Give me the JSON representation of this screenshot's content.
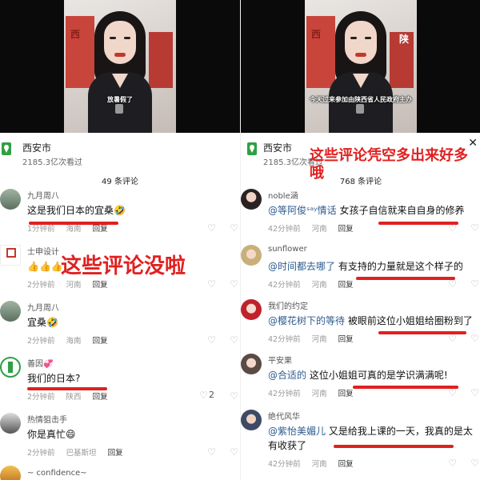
{
  "left": {
    "subtitle": "放暑假了",
    "location": {
      "name": "西安市",
      "views": "2185.3亿次看过"
    },
    "comment_count": "49 条评论",
    "annotation": "这些评论没啦",
    "comments": [
      {
        "user": "九月周八",
        "text": "这是我们日本的宜桑🤣",
        "time": "1分钟前",
        "region": "海南",
        "reply": "回复",
        "likes": ""
      },
      {
        "user": "士申设计",
        "text": "👍👍👍",
        "time": "2分钟前",
        "region": "河南",
        "reply": "回复",
        "likes": ""
      },
      {
        "user": "九月周八",
        "text": "宜桑🤣",
        "time": "2分钟前",
        "region": "海南",
        "reply": "回复",
        "likes": ""
      },
      {
        "user": "善因💞",
        "text": "我们的日本?",
        "time": "2分钟前",
        "region": "陕西",
        "reply": "回复",
        "likes": "2"
      },
      {
        "user": "热情狙击手",
        "text": "你是真忙😄",
        "time": "2分钟前",
        "region": "巴基斯坦",
        "reply": "回复",
        "likes": ""
      },
      {
        "user": "~ confidence~",
        "text": "",
        "time": "",
        "region": "",
        "reply": "",
        "likes": ""
      }
    ]
  },
  "right": {
    "subtitle": "今天过来参加由陕西省人民政府主办",
    "location": {
      "name": "西安市",
      "views": "2185.3亿次看过"
    },
    "comment_count": "768 条评论",
    "annotation": "这些评论凭空多出来好多哦",
    "comments": [
      {
        "user": "noble涵",
        "mention": "@等阿俊ˢᵃʸ情话",
        "text": "女孩子自信就来自自身的修养",
        "time": "42分钟前",
        "region": "河南",
        "reply": "回复"
      },
      {
        "user": "sunflower",
        "mention": "@时间都去哪了",
        "text": "有支持的力量就是这个样子的",
        "time": "42分钟前",
        "region": "河南",
        "reply": "回复"
      },
      {
        "user": "我们的约定",
        "mention": "@樱花树下的等待",
        "text": "被眼前这位小姐姐给圈粉到了",
        "time": "42分钟前",
        "region": "河南",
        "reply": "回复"
      },
      {
        "user": "平安果",
        "mention": "@合适的",
        "text": "这位小姐姐可真的是学识满满呢!",
        "time": "42分钟前",
        "region": "河南",
        "reply": "回复"
      },
      {
        "user": "绝代风华",
        "mention": "@紫怡美媚儿",
        "text": "又是给我上课的一天，我真的是太有收获了",
        "time": "42分钟前",
        "region": "河南",
        "reply": "回复"
      }
    ]
  },
  "colors": {
    "annotation": "#e02020",
    "mention": "#2d5b8f",
    "location_icon": "#2ea043"
  }
}
